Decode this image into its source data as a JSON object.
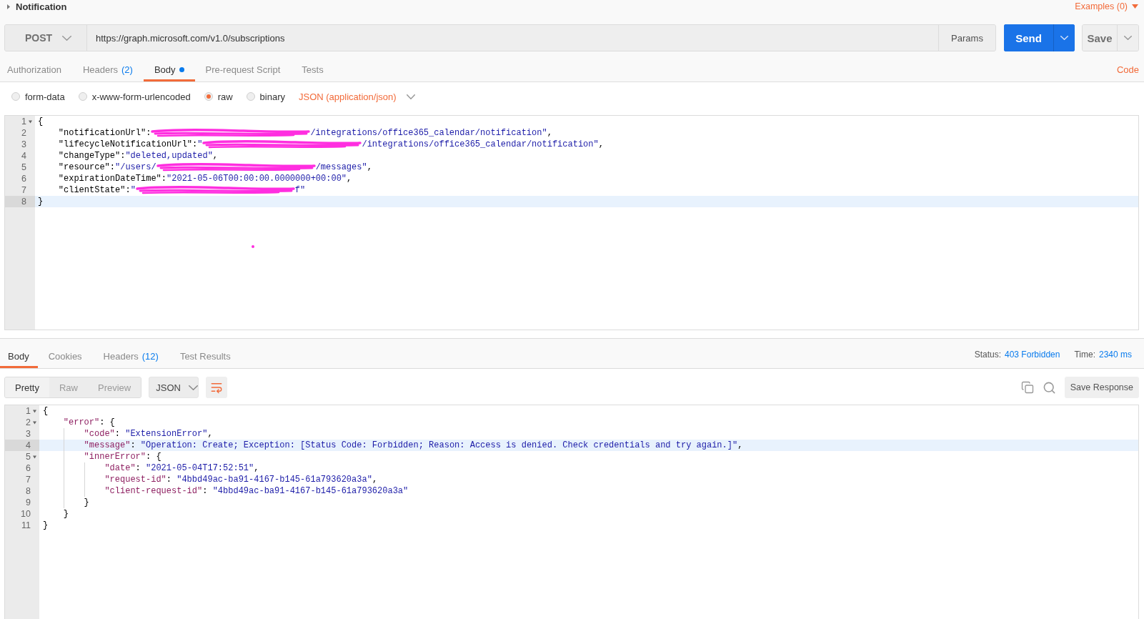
{
  "request": {
    "title": "Notification",
    "examples_link": "Examples (0)",
    "method": "POST",
    "url": "https://graph.microsoft.com/v1.0/subscriptions",
    "params_button": "Params",
    "send_button": "Send",
    "save_button": "Save",
    "tabs": [
      {
        "label": "Authorization",
        "selected": false,
        "modified": false
      },
      {
        "label": "Headers",
        "count": "(2)",
        "selected": false,
        "modified": false
      },
      {
        "label": "Body",
        "selected": true,
        "modified": true
      },
      {
        "label": "Pre-request Script",
        "selected": false,
        "modified": false
      },
      {
        "label": "Tests",
        "selected": false,
        "modified": false
      }
    ],
    "code_link": "Code",
    "body_types": [
      {
        "label": "form-data",
        "selected": false
      },
      {
        "label": "x-www-form-urlencoded",
        "selected": false
      },
      {
        "label": "raw",
        "selected": true
      },
      {
        "label": "binary",
        "selected": false
      }
    ],
    "body_format": "JSON (application/json)",
    "body_editor": {
      "lines": [
        {
          "number": "1",
          "active": false,
          "expanded": true,
          "tokens": [
            {
              "kind": "plain",
              "text": "{"
            }
          ],
          "children": [
            {
              "number": "2",
              "active": false,
              "tokens": [
                {
                  "kind": "plain",
                  "text": "\"notificationUrl\":"
                },
                {
                  "kind": "redacted"
                },
                {
                  "kind": "string",
                  "text": "/integrations/office365_calendar/notification\""
                },
                {
                  "kind": "plain",
                  "text": ","
                }
              ]
            },
            {
              "number": "3",
              "active": false,
              "tokens": [
                {
                  "kind": "plain",
                  "text": "\"lifecycleNotificationUrl\":"
                },
                {
                  "kind": "string",
                  "text": "\""
                },
                {
                  "kind": "redacted"
                },
                {
                  "kind": "string",
                  "text": "/integrations/office365_calendar/notification\""
                },
                {
                  "kind": "plain",
                  "text": ","
                }
              ]
            },
            {
              "number": "4",
              "active": false,
              "tokens": [
                {
                  "kind": "plain",
                  "text": "\"changeType\":"
                },
                {
                  "kind": "string",
                  "text": "\"deleted,updated\""
                },
                {
                  "kind": "plain",
                  "text": ","
                }
              ]
            },
            {
              "number": "5",
              "active": false,
              "tokens": [
                {
                  "kind": "plain",
                  "text": "\"resource\":"
                },
                {
                  "kind": "string",
                  "text": "\"/users/"
                },
                {
                  "kind": "redacted"
                },
                {
                  "kind": "string",
                  "text": "/messages\""
                },
                {
                  "kind": "plain",
                  "text": ","
                }
              ]
            },
            {
              "number": "6",
              "active": false,
              "tokens": [
                {
                  "kind": "plain",
                  "text": "\"expirationDateTime\":"
                },
                {
                  "kind": "string",
                  "text": "\"2021-05-06T00:00:00.0000000+00:00\""
                },
                {
                  "kind": "plain",
                  "text": ","
                }
              ]
            },
            {
              "number": "7",
              "active": false,
              "tokens": [
                {
                  "kind": "plain",
                  "text": "\"clientState\":"
                },
                {
                  "kind": "string",
                  "text": "\""
                },
                {
                  "kind": "redacted"
                },
                {
                  "kind": "string",
                  "text": "f\""
                }
              ]
            }
          ]
        },
        {
          "number": "8",
          "active": true,
          "tokens": [
            {
              "kind": "plain",
              "text": "}"
            }
          ]
        }
      ]
    }
  },
  "response": {
    "tabs": [
      {
        "label": "Body",
        "selected": true
      },
      {
        "label": "Cookies",
        "selected": false
      },
      {
        "label": "Headers",
        "count": "(12)",
        "selected": false
      },
      {
        "label": "Test Results",
        "selected": false
      }
    ],
    "status": {
      "label": "Status:",
      "value": "403 Forbidden"
    },
    "time": {
      "label": "Time:",
      "value": "2340 ms"
    },
    "view_modes": [
      {
        "label": "Pretty",
        "selected": true
      },
      {
        "label": "Raw",
        "selected": false
      },
      {
        "label": "Preview",
        "selected": false
      }
    ],
    "format": "JSON",
    "wrap_lines": true,
    "save_response_button": "Save Response",
    "body_viewer": {
      "lines": [
        {
          "number": "1",
          "active": false,
          "expanded": true,
          "tokens": [
            {
              "kind": "plain",
              "text": "{"
            }
          ],
          "children": [
            {
              "number": "2",
              "active": false,
              "expanded": true,
              "tokens": [
                {
                  "kind": "key",
                  "text": "\"error\""
                },
                {
                  "kind": "plain",
                  "text": ": {"
                }
              ],
              "children": [
                {
                  "number": "3",
                  "active": false,
                  "tokens": [
                    {
                      "kind": "key",
                      "text": "\"code\""
                    },
                    {
                      "kind": "plain",
                      "text": ": "
                    },
                    {
                      "kind": "string",
                      "text": "\"ExtensionError\""
                    },
                    {
                      "kind": "plain",
                      "text": ","
                    }
                  ]
                },
                {
                  "number": "4",
                  "active": true,
                  "tokens": [
                    {
                      "kind": "key",
                      "text": "\"message\""
                    },
                    {
                      "kind": "plain",
                      "text": ": "
                    },
                    {
                      "kind": "string",
                      "text": "\"Operation: Create; Exception: [Status Code: Forbidden; Reason: Access is denied. Check credentials and try again.]\""
                    },
                    {
                      "kind": "plain",
                      "text": ","
                    }
                  ]
                },
                {
                  "number": "5",
                  "active": false,
                  "expanded": true,
                  "tokens": [
                    {
                      "kind": "key",
                      "text": "\"innerError\""
                    },
                    {
                      "kind": "plain",
                      "text": ": {"
                    }
                  ],
                  "children": [
                    {
                      "number": "6",
                      "active": false,
                      "tokens": [
                        {
                          "kind": "key",
                          "text": "\"date\""
                        },
                        {
                          "kind": "plain",
                          "text": ": "
                        },
                        {
                          "kind": "string",
                          "text": "\"2021-05-04T17:52:51\""
                        },
                        {
                          "kind": "plain",
                          "text": ","
                        }
                      ]
                    },
                    {
                      "number": "7",
                      "active": false,
                      "tokens": [
                        {
                          "kind": "key",
                          "text": "\"request-id\""
                        },
                        {
                          "kind": "plain",
                          "text": ": "
                        },
                        {
                          "kind": "string",
                          "text": "\"4bbd49ac-ba91-4167-b145-61a793620a3a\""
                        },
                        {
                          "kind": "plain",
                          "text": ","
                        }
                      ]
                    },
                    {
                      "number": "8",
                      "active": false,
                      "tokens": [
                        {
                          "kind": "key",
                          "text": "\"client-request-id\""
                        },
                        {
                          "kind": "plain",
                          "text": ": "
                        },
                        {
                          "kind": "string",
                          "text": "\"4bbd49ac-ba91-4167-b145-61a793620a3a\""
                        }
                      ]
                    }
                  ]
                },
                {
                  "number": "9",
                  "active": false,
                  "tokens": [
                    {
                      "kind": "plain",
                      "text": "}"
                    }
                  ]
                }
              ]
            },
            {
              "number": "10",
              "active": false,
              "tokens": [
                {
                  "kind": "plain",
                  "text": "}"
                }
              ]
            }
          ]
        },
        {
          "number": "11",
          "active": false,
          "tokens": [
            {
              "kind": "plain",
              "text": "}"
            }
          ]
        }
      ]
    }
  }
}
